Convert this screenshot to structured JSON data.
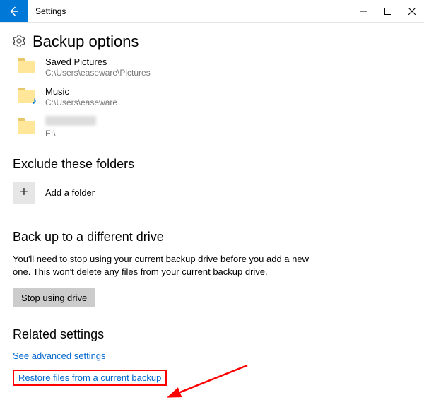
{
  "titlebar": {
    "app_title": "Settings"
  },
  "page": {
    "title": "Backup options"
  },
  "folders": [
    {
      "name": "Saved Pictures",
      "path": "C:\\Users\\easeware\\Pictures"
    },
    {
      "name": "Music",
      "path": "C:\\Users\\easeware"
    },
    {
      "name": "",
      "path": "E:\\"
    }
  ],
  "exclude": {
    "heading": "Exclude these folders",
    "add_label": "Add a folder"
  },
  "backup_drive": {
    "heading": "Back up to a different drive",
    "description": "You'll need to stop using your current backup drive before you add a new one. This won't delete any files from your current backup drive.",
    "button": "Stop using drive"
  },
  "related": {
    "heading": "Related settings",
    "link_advanced": "See advanced settings",
    "link_restore": "Restore files from a current backup"
  }
}
